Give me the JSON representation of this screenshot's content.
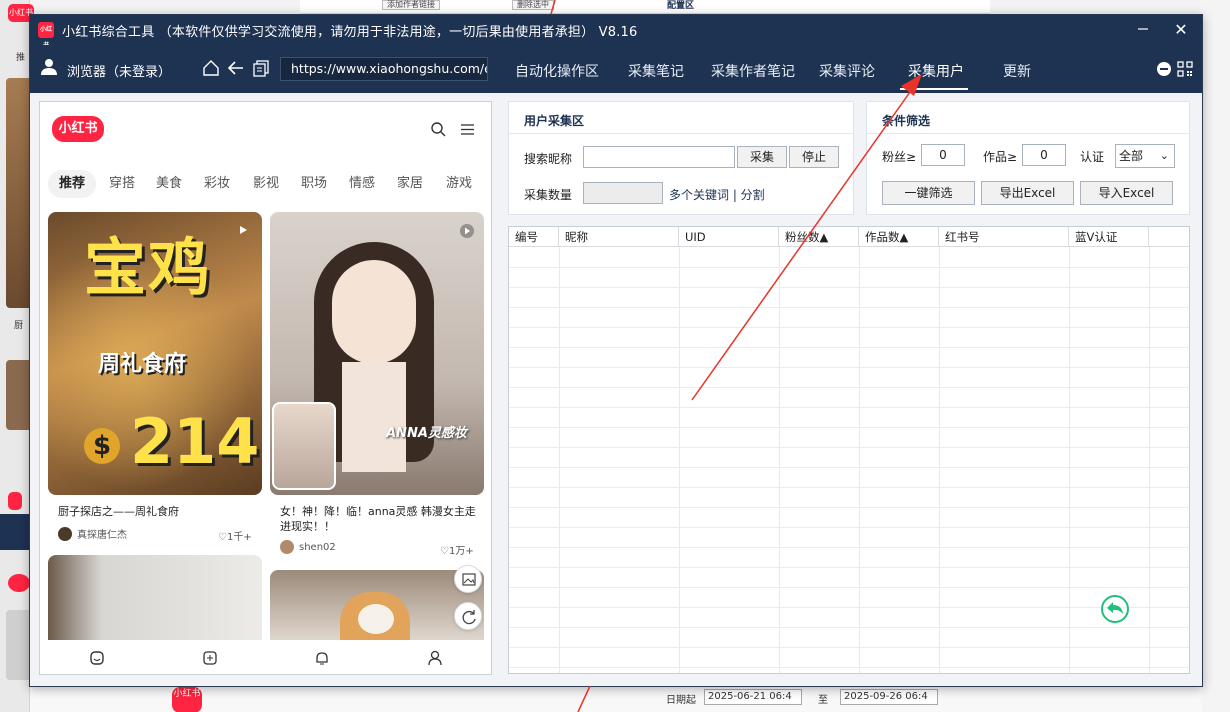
{
  "background": {
    "left_badge_text": "小红书",
    "left_small_text_1": "推",
    "left_small_text_2": "厨",
    "top_strip_button_1": "添加作者链接",
    "top_strip_button_2": "删除选中",
    "top_strip_section": "配置区",
    "bottom_date_label": "日期起",
    "bottom_date_from": "2025-06-21 06:4",
    "bottom_to_label": "至",
    "bottom_date_to": "2025-09-26 06:4",
    "bottom_badge": "小红书"
  },
  "window": {
    "title": "小红书综合工具 （本软件仅供学习交流使用，请勿用于非法用途，一切后果由使用者承担） V8.16",
    "logo_text": "小红书",
    "close_symbol": "✕"
  },
  "navbar": {
    "browser_label": "浏览器（未登录）",
    "url": "https://www.xiaohongshu.com/e",
    "tabs": [
      {
        "label": "自动化操作区"
      },
      {
        "label": "采集笔记"
      },
      {
        "label": "采集作者笔记"
      },
      {
        "label": "采集评论"
      },
      {
        "label": "采集用户"
      },
      {
        "label": "更新"
      }
    ],
    "active_tab": "采集用户"
  },
  "phone": {
    "logo": "小红书",
    "categories": [
      "推荐",
      "穿搭",
      "美食",
      "彩妆",
      "影视",
      "职场",
      "情感",
      "家居",
      "游戏"
    ],
    "active_category": "推荐",
    "cards": [
      {
        "overlay_line1": "宝鸡",
        "overlay_line2": "周礼食府",
        "overlay_line3": "214",
        "title": "厨子探店之——周礼食府",
        "author": "真探唐仁杰",
        "likes": "1千+"
      },
      {
        "overlay_line1": "ANNA灵感妆",
        "title": "女！神！降！临！anna灵感 韩漫女主走进现实！！",
        "author": "shen02",
        "likes": "1万+"
      }
    ]
  },
  "user_collect": {
    "title": "用户采集区",
    "nickname_label": "搜索昵称",
    "nickname_value": "",
    "collect_button": "采集",
    "stop_button": "停止",
    "count_label": "采集数量",
    "count_value": "",
    "keyword_hint": "多个关键词 | 分割"
  },
  "filter": {
    "title": "条件筛选",
    "fans_label": "粉丝≥",
    "fans_value": "0",
    "works_label": "作品≥",
    "works_value": "0",
    "verify_label": "认证",
    "verify_value": "全部",
    "filter_button": "一键筛选",
    "export_button": "导出Excel",
    "import_button": "导入Excel"
  },
  "table": {
    "columns": [
      "编号",
      "昵称",
      "UID",
      "粉丝数▲",
      "作品数▲",
      "红书号",
      "蓝V认证"
    ],
    "rows": []
  },
  "colors": {
    "titlebar": "#1e3252",
    "brand_red": "#ff2442",
    "accent_green": "#21c07a",
    "annotation_arrow": "#e8332a"
  }
}
